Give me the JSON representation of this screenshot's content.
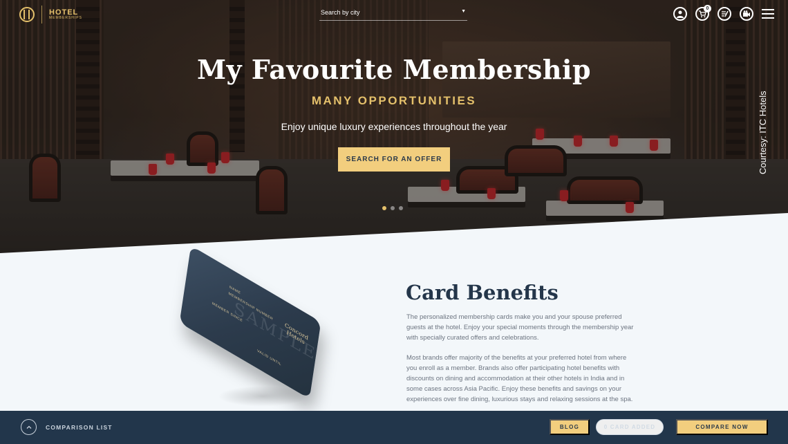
{
  "header": {
    "logo_text": "HOTEL",
    "logo_sub": "MEMBERSHIPS",
    "search_placeholder": "Search by city",
    "cart_count": "0",
    "icons": [
      "user-icon",
      "cart-icon",
      "blog-icon",
      "video-icon",
      "menu-icon"
    ]
  },
  "hero": {
    "title": "My Favourite Membership",
    "subtitle": "MANY OPPORTUNITIES",
    "description": "Enjoy unique luxury experiences throughout the year",
    "cta": "SEARCH FOR AN OFFER",
    "courtesy": "Courtesy: ITC Hotels",
    "slides_total": 3,
    "slide_active": 1
  },
  "card": {
    "watermark": "SAMPLE",
    "brand": "Concord Hotels",
    "name_label": "NAME",
    "number_label": "MEMBERSHIP NUMBER",
    "member_since": "MEMBER SINCE",
    "valid_until": "VALID UNTIL"
  },
  "benefits": {
    "title": "Card Benefits",
    "paragraph1": "The personalized membership cards make you and your spouse preferred guests at the hotel. Enjoy your special moments through the membership year with specially curated offers and celebrations.",
    "paragraph2": "Most brands offer majority of the benefits at your preferred hotel from where you enroll as a member. Brands also offer participating hotel benefits with discounts on dining and accommodation at their other hotels in India and in some cases across Asia Pacific. Enjoy these benefits and savings on your experiences over fine dining, luxurious stays and relaxing sessions at the spa."
  },
  "bottom_bar": {
    "comparison_label": "COMPARISON LIST",
    "blog": "BLOG",
    "card_added": "0 CARD ADDED",
    "compare_now": "COMPARE NOW"
  },
  "colors": {
    "accent": "#f2ce7e",
    "gold_text": "#e4c06b",
    "navy": "#22364b",
    "heading": "#24364a"
  }
}
